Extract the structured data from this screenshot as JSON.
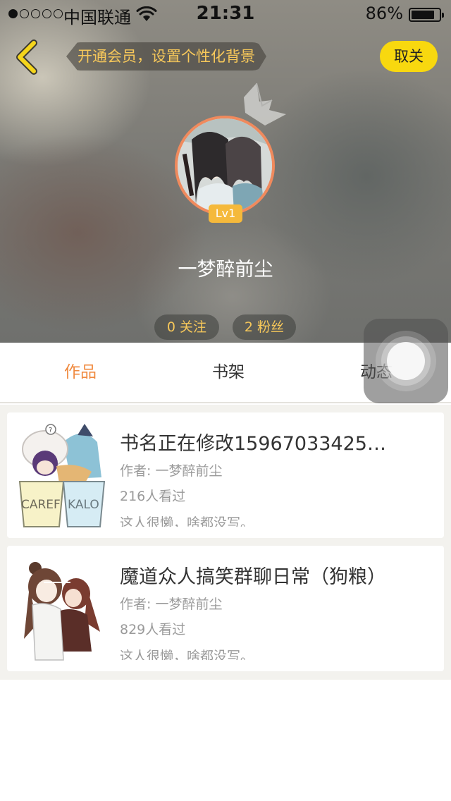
{
  "status_bar": {
    "carrier": "中国联通",
    "time": "21:31",
    "battery_percent": "86%",
    "signal_bars": 1,
    "signal_total": 5,
    "battery_level": 0.86
  },
  "header": {
    "vip_prompt": "开通会员，设置个性化背景",
    "cancel_label": "取关",
    "back_icon": "chevron-left-icon",
    "crown_icon": "crown-icon"
  },
  "profile": {
    "level": "Lv1",
    "username": "一梦醉前尘",
    "following_label": "0 关注",
    "fans_label": "2 粉丝"
  },
  "tabs": [
    {
      "label": "作品",
      "active": true
    },
    {
      "label": "书架",
      "active": false
    },
    {
      "label": "动态",
      "active": false
    }
  ],
  "works": [
    {
      "title": "书名正在修改15967033425…",
      "author": "作者: 一梦醉前尘",
      "views": "216人看过",
      "desc": "这人很懒，啥都没写。",
      "cover_text_left": "CAREF",
      "cover_text_right": "KALO"
    },
    {
      "title": "魔道众人搞笑群聊日常（狗粮）",
      "author": "作者: 一梦醉前尘",
      "views": "829人看过",
      "desc": "这人很懒，啥都没写。"
    }
  ],
  "colors": {
    "accent_orange": "#f08a3f",
    "vip_gold": "#f7c85a",
    "cancel_yellow": "#f8d80f",
    "avatar_ring": "#f08a5d"
  }
}
